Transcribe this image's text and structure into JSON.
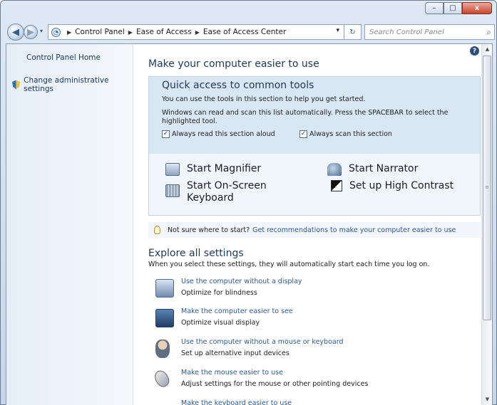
{
  "window": {
    "controls": {
      "minimize": "–",
      "maximize": "□",
      "close": "x"
    }
  },
  "navigation": {
    "back": "◀",
    "forward": "▶",
    "recent": "▾",
    "breadcrumb": [
      "Control Panel",
      "Ease of Access",
      "Ease of Access Center"
    ],
    "dropdown": "▾",
    "refresh": "↻",
    "search_placeholder": "Search Control Panel",
    "search_icon": "⌕"
  },
  "sidebar": {
    "items": [
      {
        "label": "Control Panel Home"
      },
      {
        "label": "Change administrative settings",
        "icon": "shield-icon"
      }
    ]
  },
  "main": {
    "help": "?",
    "title": "Make your computer easier to use",
    "quick_access": {
      "title": "Quick access to common tools",
      "text1": "You can use the tools in this section to help you get started.",
      "text2": "Windows can read and scan this list automatically.  Press the SPACEBAR to select the highlighted tool.",
      "checkbox_read": {
        "label": "Always read this section aloud",
        "checked": "✓"
      },
      "checkbox_scan": {
        "label": "Always scan this section",
        "checked": "✓"
      },
      "tools": [
        {
          "label": "Start Magnifier",
          "icon": "magnifier-icon"
        },
        {
          "label": "Start Narrator",
          "icon": "narrator-icon"
        },
        {
          "label": "Start On-Screen Keyboard",
          "icon": "keyboard-icon"
        },
        {
          "label": "Set up High Contrast",
          "icon": "high-contrast-icon"
        }
      ]
    },
    "tip": {
      "question": "Not sure where to start?",
      "link": "Get recommendations to make your computer easier to use"
    },
    "explore": {
      "title": "Explore all settings",
      "subtitle": "When you select these settings, they will automatically start each time you log on.",
      "settings": [
        {
          "link": "Use the computer without a display",
          "desc": "Optimize for blindness"
        },
        {
          "link": "Make the computer easier to see",
          "desc": "Optimize visual display"
        },
        {
          "link": "Use the computer without a mouse or keyboard",
          "desc": "Set up alternative input devices"
        },
        {
          "link": "Make the mouse easier to use",
          "desc": "Adjust settings for the mouse or other pointing devices"
        },
        {
          "link": "Make the keyboard easier to use",
          "desc": ""
        }
      ]
    }
  },
  "scrollbar": {
    "up": "▲",
    "down": "▼",
    "grip": "≡"
  }
}
